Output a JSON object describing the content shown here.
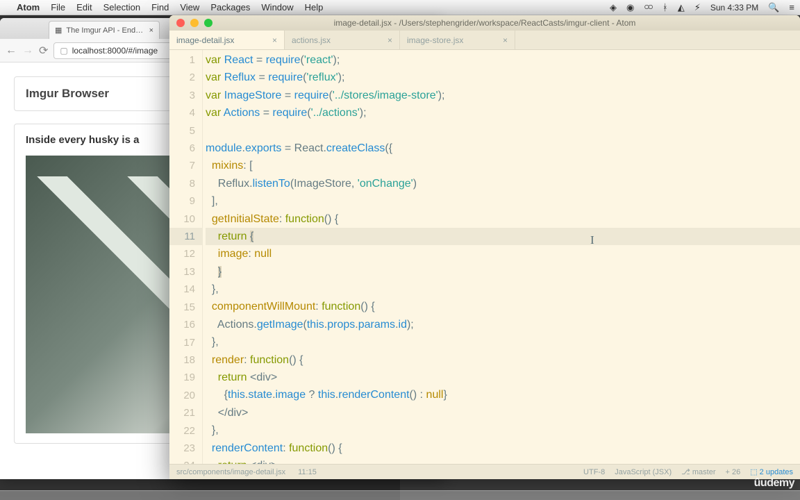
{
  "menubar": {
    "app": "Atom",
    "items": [
      "File",
      "Edit",
      "Selection",
      "Find",
      "View",
      "Packages",
      "Window",
      "Help"
    ],
    "clock": "Sun 4:33 PM"
  },
  "browser": {
    "tab_title": "The Imgur API - Endpoints",
    "url": "localhost:8000/#/image",
    "app_title": "Imgur Browser",
    "post_title": "Inside every husky is a"
  },
  "atom": {
    "title": "image-detail.jsx - /Users/stephengrider/workspace/ReactCasts/imgur-client - Atom",
    "tabs": [
      {
        "label": "image-detail.jsx",
        "active": true
      },
      {
        "label": "actions.jsx",
        "active": false
      },
      {
        "label": "image-store.jsx",
        "active": false
      }
    ],
    "status": {
      "path": "src/components/image-detail.jsx",
      "pos": "11:15",
      "encoding": "UTF-8",
      "grammar": "JavaScript (JSX)",
      "branch": "master",
      "diff": "26",
      "updates": "2 updates"
    },
    "code_lines": [
      "var React = require('react');",
      "var Reflux = require('reflux');",
      "var ImageStore = require('../stores/image-store');",
      "var Actions = require('../actions');",
      "",
      "module.exports = React.createClass({",
      "  mixins: [",
      "    Reflux.listenTo(ImageStore, 'onChange')",
      "  ],",
      "  getInitialState: function() {",
      "    return {",
      "    image: null",
      "    }",
      "  },",
      "  componentWillMount: function() {",
      "    Actions.getImage(this.props.params.id);",
      "  },",
      "  render: function() {",
      "    return <div>",
      "      {this.state.image ? this.renderContent() : null}",
      "    </div>",
      "  },",
      "  renderContent: function() {",
      "    return <div>"
    ],
    "active_line": 11
  },
  "watermark": "udemy"
}
